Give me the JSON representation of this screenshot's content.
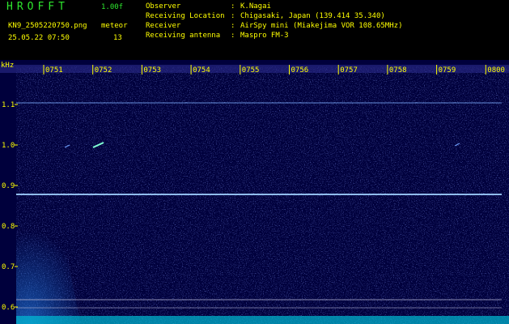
{
  "app": {
    "title": "HROFFT",
    "version": "1.00f"
  },
  "file": {
    "name": "KN9_2505220750.png",
    "datetime": "25.05.22 07:50"
  },
  "detect": {
    "type": "meteor",
    "count": "13"
  },
  "info": [
    {
      "label": "Observer",
      "sep": ":",
      "value": "K.Nagai"
    },
    {
      "label": "Receiving Location",
      "sep": ":",
      "value": "Chigasaki, Japan (139.414 35.340)"
    },
    {
      "label": "Receiver",
      "sep": ":",
      "value": "AirSpy mini (Miakejima VOR 108.65MHz)"
    },
    {
      "label": "Receiving antenna",
      "sep": ":",
      "value": "Maspro FM-3"
    }
  ],
  "axis": {
    "unit": "kHz",
    "y_ticks": [
      "1.1",
      "1.0",
      "0.9",
      "0.8",
      "0.7",
      "0.6"
    ],
    "time_ticks": [
      "0751",
      "0752",
      "0753",
      "0754",
      "0755",
      "0756",
      "0757",
      "0758",
      "0759",
      "0800"
    ]
  },
  "colors": {
    "background": "#00003c",
    "label": "#ffff00",
    "title": "#2ee62e",
    "signal": "#00e6e6"
  }
}
